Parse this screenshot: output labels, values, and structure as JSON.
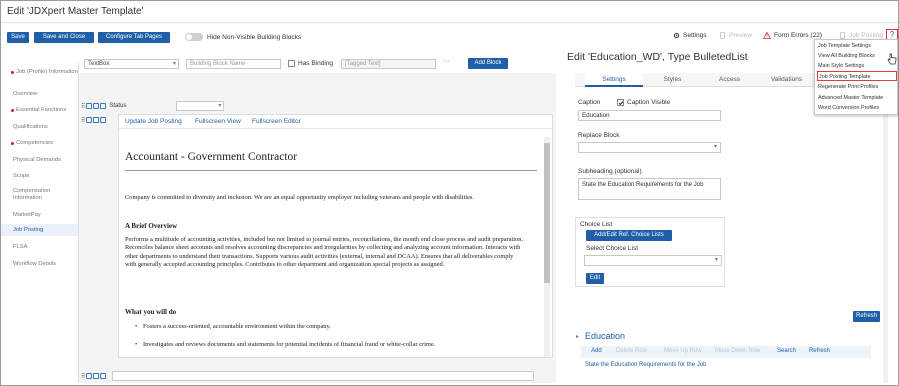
{
  "window": {
    "title": "Edit 'JDXpert Master Template'"
  },
  "toolbar": {
    "save_label": "Save",
    "save_close_label": "Save and Close",
    "configure_tabs_label": "Configure Tab Pages",
    "hide_nonvisible_label": "Hide Non-Visible Building Blocks",
    "settings_label": "Settings",
    "preview_label": "Preview",
    "form_errors_label": "Form Errors (22)",
    "job_posting_label": "Job Posting",
    "help_label": "?"
  },
  "nav": {
    "items": [
      {
        "label": "Job (Profile) Information",
        "error": true
      },
      {
        "label": "Overview",
        "error": false
      },
      {
        "label": "Essential Functions",
        "error": true
      },
      {
        "label": "Qualifications",
        "error": false
      },
      {
        "label": "Competencies",
        "error": true
      },
      {
        "label": "Physical Demands",
        "error": false
      },
      {
        "label": "Scope",
        "error": false
      },
      {
        "label": "Compensation Information",
        "error": false
      },
      {
        "label": "MarketPay",
        "error": false
      },
      {
        "label": "Job Posting",
        "error": false,
        "active": true
      },
      {
        "label": "FLSA",
        "error": false
      },
      {
        "label": "Workflow Details",
        "error": false
      }
    ]
  },
  "controls": {
    "block_type": "TextBox",
    "block_name_placeholder": "Building Block Name",
    "has_binding_label": "Has Binding",
    "tagged_text_placeholder": "[Tagged Text]",
    "more_label": "···",
    "add_block_label": "Add Block"
  },
  "center": {
    "status_label": "Status",
    "editor_tabs": [
      "Update Job Posting",
      "Fullscreen View",
      "Fullscreen Editor"
    ]
  },
  "document": {
    "title": "Accountant - Government Contractor",
    "intro": "Company is committed to diversity and inclusion. We are an equal opportunity employer including veterans and people with disabilities.",
    "overview_heading": "A Brief Overview",
    "overview_text": "Performs a multitude of accounting activities, included but not limited to journal entries, reconciliations, the month end close process and audit preparation. Reconciles balance sheet accounts and resolves accounting discrepancies and irregularities by collecting and analyzing account information. Interacts with other departments to understand their transactions. Supports various audit activities (external, internal and DCAA). Ensures that all deliverables comply with generally accepted accounting principles. Contributes to other department and organization special projects as assigned.",
    "what_heading": "What you will do",
    "bullets": [
      "Fosters a success-oriented, accountable environment within the company.",
      "Investigates and reviews documents and statements for potential incidents of financial fraud or white-collar crime."
    ]
  },
  "right_panel": {
    "title": "Edit 'Education_WD', Type BulletedList",
    "tabs": [
      "Settings",
      "Styles",
      "Access",
      "Validations"
    ],
    "active_tab": "Settings",
    "caption_label": "Caption",
    "caption_visible_label": "Caption Visible",
    "caption_value": "Education",
    "replace_block_label": "Replace Block",
    "subheading_label": "Subheading (optional)",
    "subheading_value": "State the Education Requirements for the Job",
    "choice_list_label": "Choice List",
    "add_edit_choice_label": "Add/Edit Ref. Choice Lists",
    "select_choice_label": "Select Choice List",
    "edit_label": "Edit",
    "refresh_label": "Refresh",
    "education": {
      "title": "Education",
      "actions": [
        {
          "label": "Add",
          "enabled": true
        },
        {
          "label": "Delete Row",
          "enabled": false
        },
        {
          "label": "Move Up Row",
          "enabled": false
        },
        {
          "label": "Move Down Row",
          "enabled": false
        },
        {
          "label": "Search",
          "enabled": true
        },
        {
          "label": "Refresh",
          "enabled": true
        }
      ],
      "row_text": "State the Education Requirements for the Job"
    }
  },
  "dropdown_menu": {
    "items": [
      {
        "label": "Job Template Settings",
        "highlighted": false
      },
      {
        "label": "View All Building Blocks",
        "highlighted": false
      },
      {
        "label": "Main Style Settings",
        "highlighted": false
      },
      {
        "label": "Job Posting Template",
        "highlighted": true
      },
      {
        "label": "Regenerate Print Profiles",
        "highlighted": false
      },
      {
        "label": "Advanced Master Template",
        "highlighted": false
      },
      {
        "label": "Word Conversion Profiles",
        "highlighted": false
      }
    ]
  },
  "colors": {
    "accent": "#1f5fa8",
    "error": "#c62828",
    "highlight_border": "#e53935"
  }
}
